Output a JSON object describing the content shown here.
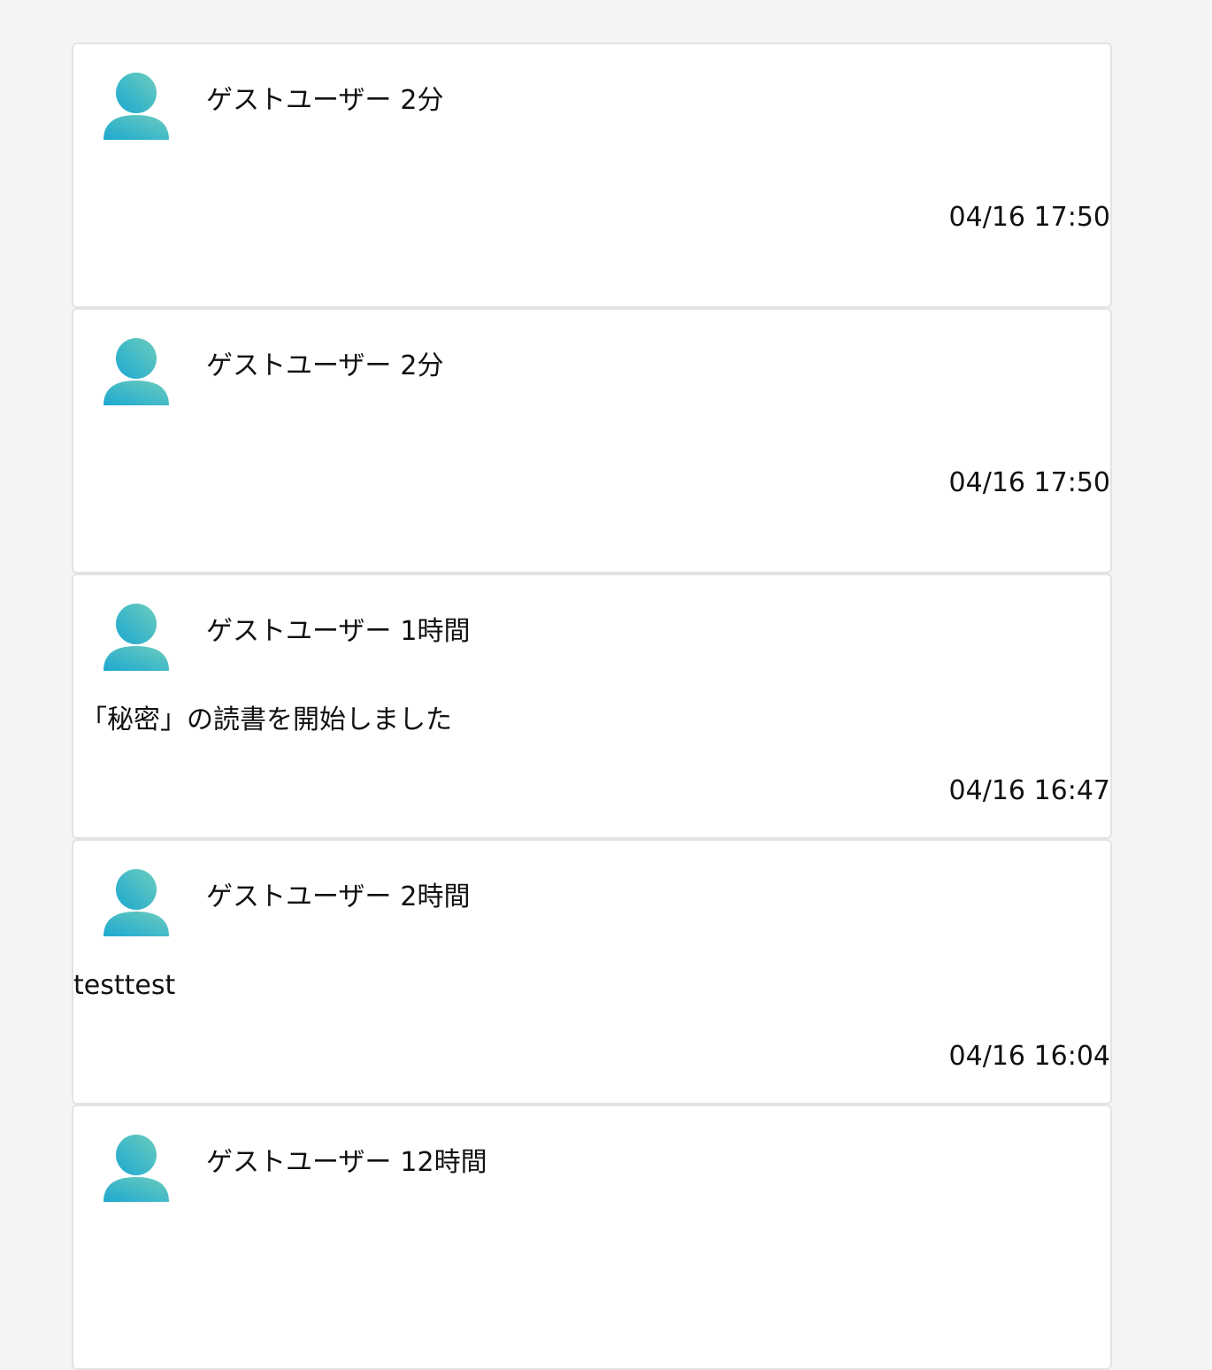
{
  "accent_gradient": [
    "#6ccdbd",
    "#1da8d0"
  ],
  "avatar_icon": "user-icon",
  "posts": [
    {
      "user": "ゲストユーザー",
      "relative_time": "2分",
      "body": "",
      "timestamp": "04/16 17:50"
    },
    {
      "user": "ゲストユーザー",
      "relative_time": "2分",
      "body": "",
      "timestamp": "04/16 17:50"
    },
    {
      "user": "ゲストユーザー",
      "relative_time": "1時間",
      "body": "「秘密」の読書を開始しました",
      "timestamp": "04/16 16:47"
    },
    {
      "user": "ゲストユーザー",
      "relative_time": "2時間",
      "body": "testtest",
      "timestamp": "04/16 16:04"
    },
    {
      "user": "ゲストユーザー",
      "relative_time": "12時間",
      "body": "",
      "timestamp": ""
    }
  ]
}
